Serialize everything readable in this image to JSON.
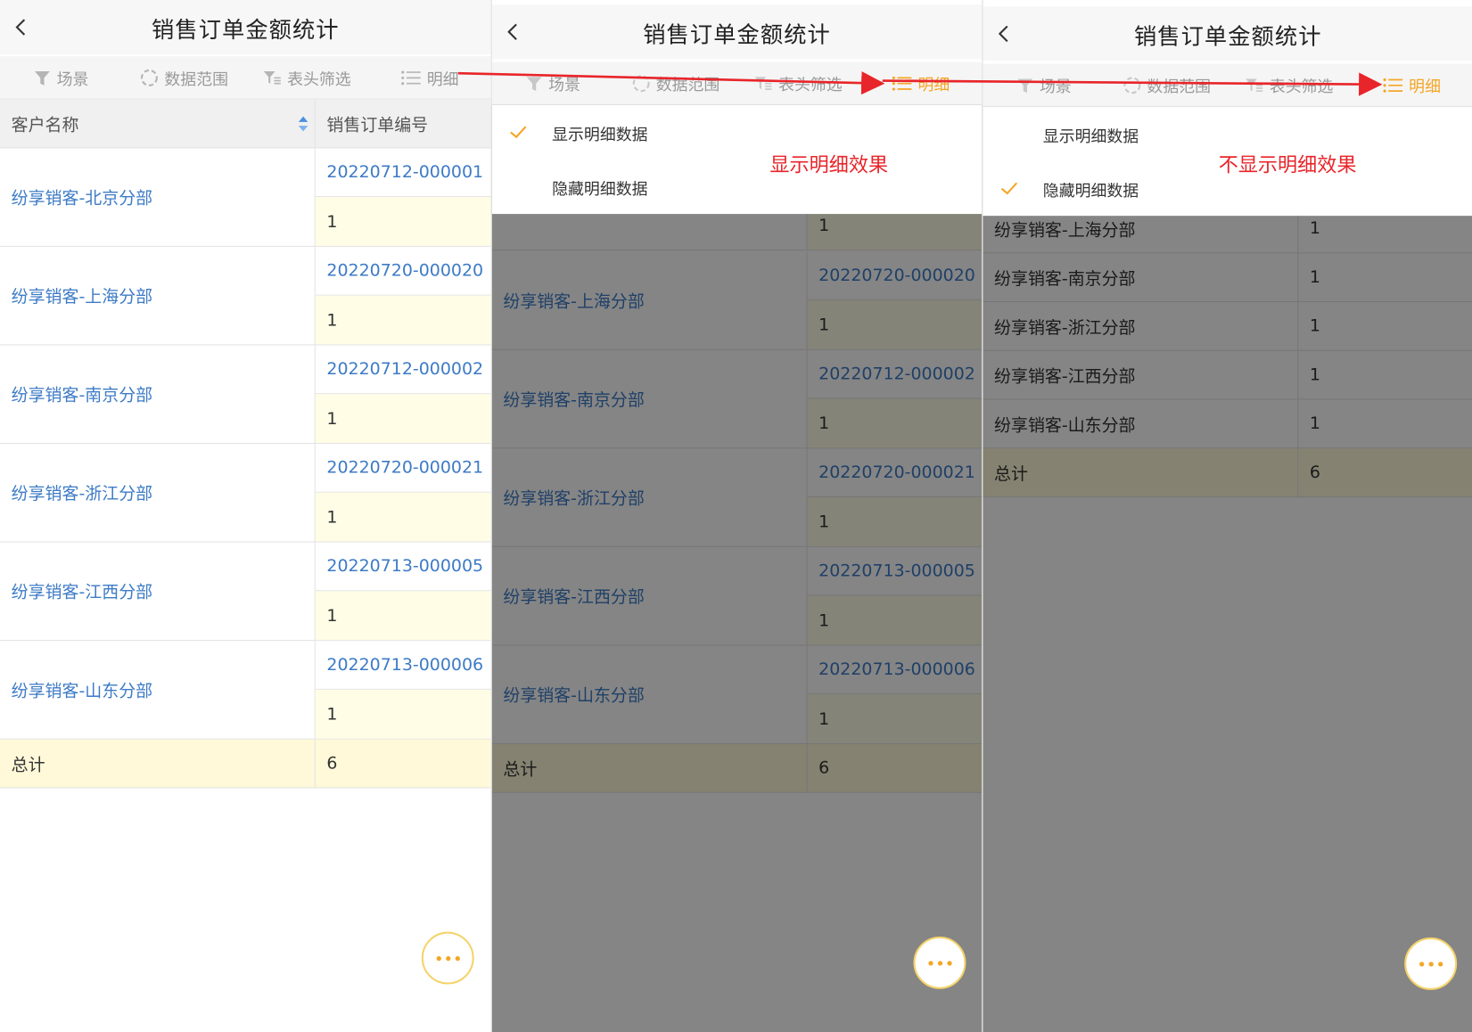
{
  "title": "销售订单金额统计",
  "toolbar": [
    "场景",
    "数据范围",
    "表头筛选",
    "明细"
  ],
  "headers": {
    "customer": "客户名称",
    "order_no": "销售订单编号"
  },
  "rows": [
    {
      "customer": "纷享销客-北京分部",
      "order": "20220712-000001",
      "amount": "1"
    },
    {
      "customer": "纷享销客-上海分部",
      "order": "20220720-000020",
      "amount": "1"
    },
    {
      "customer": "纷享销客-南京分部",
      "order": "20220712-000002",
      "amount": "1"
    },
    {
      "customer": "纷享销客-浙江分部",
      "order": "20220720-000021",
      "amount": "1"
    },
    {
      "customer": "纷享销客-江西分部",
      "order": "20220713-000005",
      "amount": "1"
    },
    {
      "customer": "纷享销客-山东分部",
      "order": "20220713-000006",
      "amount": "1"
    }
  ],
  "total": {
    "label": "总计",
    "value": "6"
  },
  "summary_rows": [
    {
      "customer": "纷享销客-上海分部",
      "amount": "1"
    },
    {
      "customer": "纷享销客-南京分部",
      "amount": "1"
    },
    {
      "customer": "纷享销客-浙江分部",
      "amount": "1"
    },
    {
      "customer": "纷享销客-江西分部",
      "amount": "1"
    },
    {
      "customer": "纷享销客-山东分部",
      "amount": "1"
    }
  ],
  "detail_menu": {
    "show": "显示明细数据",
    "hide": "隐藏明细数据"
  },
  "annotations": {
    "show_effect": "显示明细效果",
    "hide_effect": "不显示明细效果"
  },
  "colors": {
    "accent": "#f5a623",
    "link": "#3d7bc6",
    "annotation": "#e8252a",
    "arrow": "#e8252a"
  }
}
